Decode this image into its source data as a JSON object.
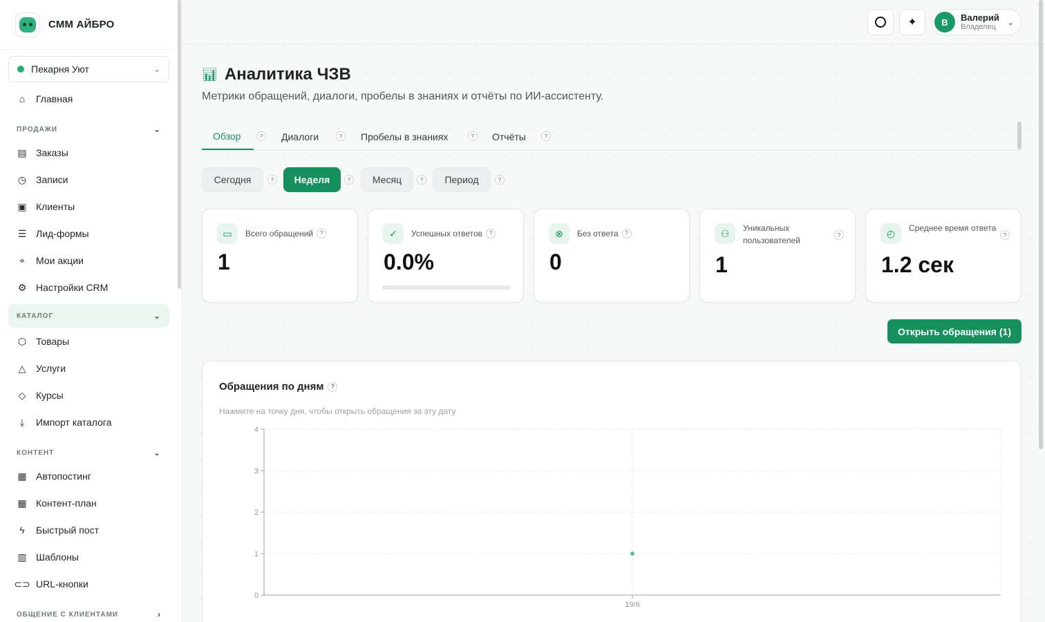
{
  "brand": {
    "name": "СММ АЙБРО"
  },
  "business": {
    "name": "Пекарня Уют"
  },
  "sidebar": {
    "home": "Главная",
    "sales": {
      "title": "ПРОДАЖИ",
      "items": [
        "Заказы",
        "Записи",
        "Клиенты",
        "Лид-формы",
        "Мои акции",
        "Настройки CRM"
      ]
    },
    "catalog": {
      "title": "КАТАЛОГ",
      "items": [
        "Товары",
        "Услуги",
        "Курсы",
        "Импорт каталога"
      ]
    },
    "content": {
      "title": "КОНТЕНТ",
      "items": [
        "Автопостинг",
        "Контент-план",
        "Быстрый пост",
        "Шаблоны",
        "URL-кнопки"
      ]
    },
    "communication": {
      "title": "ОБЩЕНИЕ С КЛИЕНТАМИ"
    }
  },
  "user": {
    "initial": "В",
    "name": "Валерий",
    "role": "Владелец"
  },
  "page": {
    "title": "Аналитика ЧЗВ",
    "subtitle": "Метрики обращений, диалоги, пробелы в знаниях и отчёты по ИИ-ассистенту."
  },
  "tabs": [
    "Обзор",
    "Диалоги",
    "Пробелы в знаниях",
    "Отчёты"
  ],
  "periods": [
    "Сегодня",
    "Неделя",
    "Месяц",
    "Период"
  ],
  "cards": [
    {
      "label": "Всего обращений",
      "value": "1"
    },
    {
      "label": "Успешных ответов",
      "value": "0.0%",
      "progress": 0
    },
    {
      "label": "Без ответа",
      "value": "0"
    },
    {
      "label": "Уникальных пользователей",
      "value": "1"
    },
    {
      "label": "Среднее время ответа",
      "value": "1.2 сек"
    }
  ],
  "help_mark": "?",
  "open_button": "Открыть обращения (1)",
  "chart": {
    "title": "Обращения по дням",
    "hint": "Нажмите на точку дня, чтобы открыть обращения за эту дату"
  },
  "chart_data": {
    "type": "line",
    "title": "Обращения по дням",
    "categories": [
      "19/6"
    ],
    "series": [
      {
        "values": [
          1
        ]
      }
    ],
    "ylim": [
      0,
      4
    ],
    "yticks": [
      "0",
      "1",
      "2",
      "3",
      "4"
    ],
    "grid": true,
    "color": "#4fc08d"
  }
}
